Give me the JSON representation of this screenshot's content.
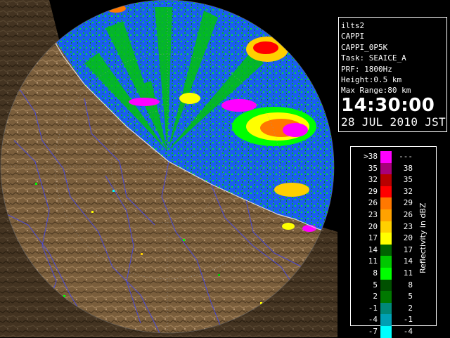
{
  "info": {
    "lines": [
      "ilts2",
      "CAPPI",
      "CAPPI_0P5K",
      "Task: SEAICE_A",
      "PRF: 1800Hz",
      "Height:0.5 km",
      "Max Range:80 km"
    ],
    "time": "14:30:00",
    "date": "28 JUL 2010 JST"
  },
  "legend": {
    "unit": "Reflectivity in dBZ",
    "rows": [
      {
        "lo": ">38",
        "hi": "---",
        "color": "#ff00ff"
      },
      {
        "lo": "35",
        "hi": "38",
        "color": "#a8007a"
      },
      {
        "lo": "32",
        "hi": "35",
        "color": "#b80000"
      },
      {
        "lo": "29",
        "hi": "32",
        "color": "#ff0000"
      },
      {
        "lo": "26",
        "hi": "29",
        "color": "#ff7800"
      },
      {
        "lo": "23",
        "hi": "26",
        "color": "#ffa200"
      },
      {
        "lo": "20",
        "hi": "23",
        "color": "#ffd000"
      },
      {
        "lo": "17",
        "hi": "20",
        "color": "#ffff00"
      },
      {
        "lo": "14",
        "hi": "17",
        "color": "#006400"
      },
      {
        "lo": "11",
        "hi": "14",
        "color": "#00c800"
      },
      {
        "lo": "8",
        "hi": "11",
        "color": "#00ff00"
      },
      {
        "lo": "5",
        "hi": "8",
        "color": "#005000"
      },
      {
        "lo": "2",
        "hi": "5",
        "color": "#007800"
      },
      {
        "lo": "-1",
        "hi": "2",
        "color": "#008878"
      },
      {
        "lo": "-4",
        "hi": "-1",
        "color": "#00a0b4"
      },
      {
        "lo": "-7",
        "hi": "-4",
        "color": "#00ffff"
      }
    ]
  },
  "colors": {
    "sea": "#1a5ef0",
    "land": "#7a5e3c",
    "rivers": "#4a4ad8",
    "coast": "#c8c8c8"
  }
}
